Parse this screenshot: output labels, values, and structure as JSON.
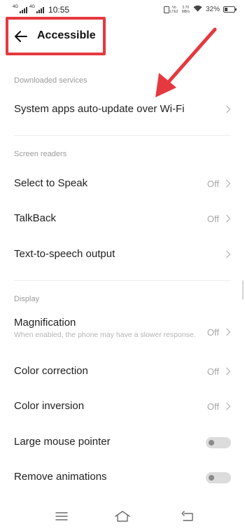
{
  "status_bar": {
    "sim1_label": "4G",
    "sim2_label": "4G",
    "time": "10:55",
    "volte_label": "Vo",
    "lte2_label": "LTE2",
    "speed_value": "3.70",
    "speed_unit": "MB/s",
    "battery_percent": "32%",
    "battery_level": 0.32
  },
  "header": {
    "back_icon": "arrow-left-icon",
    "title": "Accessible"
  },
  "sections": {
    "downloaded": {
      "title": "Downloaded services",
      "items": [
        {
          "label": "System apps auto-update over Wi-Fi",
          "value": ""
        }
      ]
    },
    "screen_readers": {
      "title": "Screen readers",
      "items": [
        {
          "label": "Select to Speak",
          "value": "Off"
        },
        {
          "label": "TalkBack",
          "value": "Off"
        },
        {
          "label": "Text-to-speech output",
          "value": ""
        }
      ]
    },
    "display": {
      "title": "Display",
      "items": [
        {
          "label": "Magnification",
          "sub": "When enabled, the phone may have a slower response.",
          "value": "Off"
        },
        {
          "label": "Color correction",
          "value": "Off"
        },
        {
          "label": "Color inversion",
          "value": "Off"
        },
        {
          "label": "Large mouse pointer",
          "toggle": false
        },
        {
          "label": "Remove animations",
          "toggle": false
        }
      ]
    }
  },
  "nav_bar": {
    "menu_icon": "menu-icon",
    "home_icon": "home-icon",
    "back_icon": "back-icon"
  },
  "annotation": {
    "highlight_color": "#e5393f",
    "arrow_color": "#e5393f"
  }
}
